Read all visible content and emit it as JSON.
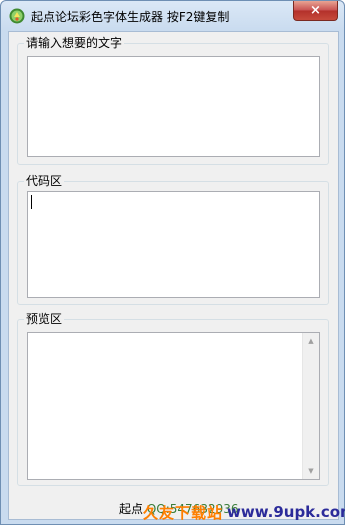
{
  "window": {
    "title": "起点论坛彩色字体生成器 按F2键复制",
    "close_label": "×"
  },
  "groups": {
    "input_label": "请输入想要的文字",
    "code_label": "代码区",
    "preview_label": "预览区"
  },
  "status": {
    "label": "起点",
    "number": "QQ:547632936"
  },
  "watermark": {
    "site_name": "久友下载站",
    "url": "www.9upk.com"
  },
  "icons": {
    "app": "app-logo-icon",
    "close": "close-icon",
    "scroll_up": "scroll-up-arrow-icon",
    "scroll_down": "scroll-down-arrow-icon"
  }
}
